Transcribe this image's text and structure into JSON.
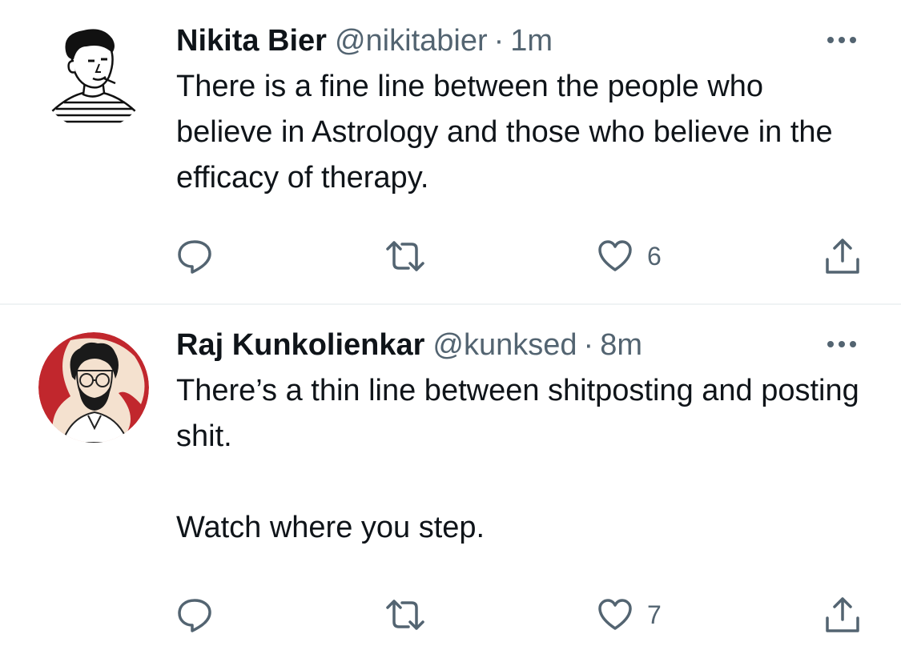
{
  "tweets": [
    {
      "display_name": "Nikita Bier",
      "handle": "@nikitabier",
      "separator": "·",
      "time": "1m",
      "text": [
        "There is a fine line between the people who believe in Astrology and those who believe in the efficacy of therapy."
      ],
      "actions": {
        "reply_icon": "reply-icon",
        "retweet_icon": "retweet-icon",
        "like_icon": "heart-icon",
        "like_count": "6",
        "share_icon": "share-icon"
      }
    },
    {
      "display_name": "Raj Kunkolienkar",
      "handle": "@kunksed",
      "separator": "·",
      "time": "8m",
      "text": [
        "There’s a thin line between shitposting and posting shit.",
        "Watch where you step."
      ],
      "actions": {
        "reply_icon": "reply-icon",
        "retweet_icon": "retweet-icon",
        "like_icon": "heart-icon",
        "like_count": "7",
        "share_icon": "share-icon"
      }
    }
  ],
  "colors": {
    "text_primary": "#0f1419",
    "text_secondary": "#536471",
    "divider": "#eff3f4",
    "avatar2_bg_red": "#c1272d",
    "avatar2_bg_cream": "#f4e1cf"
  }
}
